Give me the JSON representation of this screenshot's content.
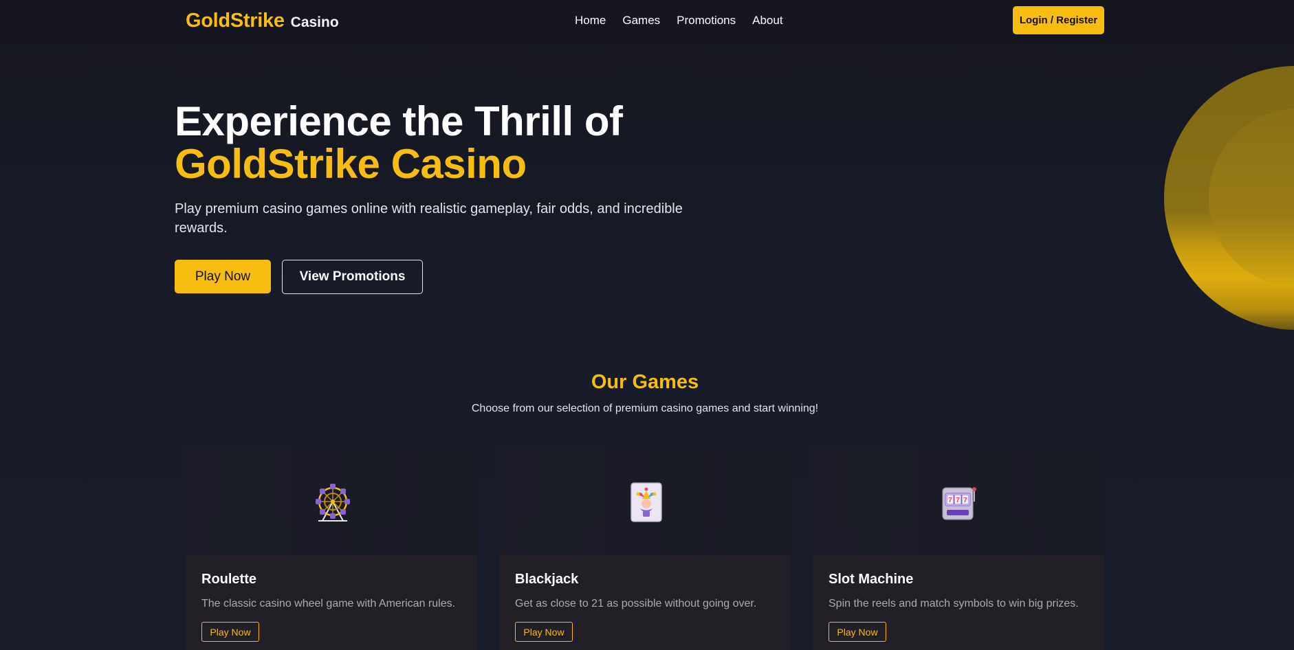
{
  "brand": {
    "name_gold": "GoldStrike",
    "name_white": "Casino",
    "accent_color": "#f7bd10",
    "background_color": "#181a26"
  },
  "nav": {
    "items": [
      {
        "label": "Home"
      },
      {
        "label": "Games"
      },
      {
        "label": "Promotions"
      },
      {
        "label": "About"
      }
    ],
    "login_label": "Login / Register"
  },
  "hero": {
    "title_line1": "Experience the Thrill of",
    "title_line2": "GoldStrike Casino",
    "subtitle": "Play premium casino games online with realistic gameplay, fair odds, and incredible rewards.",
    "primary_button": "Play Now",
    "secondary_button": "View Promotions"
  },
  "games_section": {
    "title": "Our Games",
    "subtitle": "Choose from our selection of premium casino games and start winning!",
    "cards": [
      {
        "title": "Roulette",
        "description": "The classic casino wheel game with American rules.",
        "button": "Play Now",
        "icon": "ferris-wheel-icon"
      },
      {
        "title": "Blackjack",
        "description": "Get as close to 21 as possible without going over.",
        "button": "Play Now",
        "icon": "joker-card-icon"
      },
      {
        "title": "Slot Machine",
        "description": "Spin the reels and match symbols to win big prizes.",
        "button": "Play Now",
        "icon": "slot-machine-icon"
      }
    ]
  }
}
